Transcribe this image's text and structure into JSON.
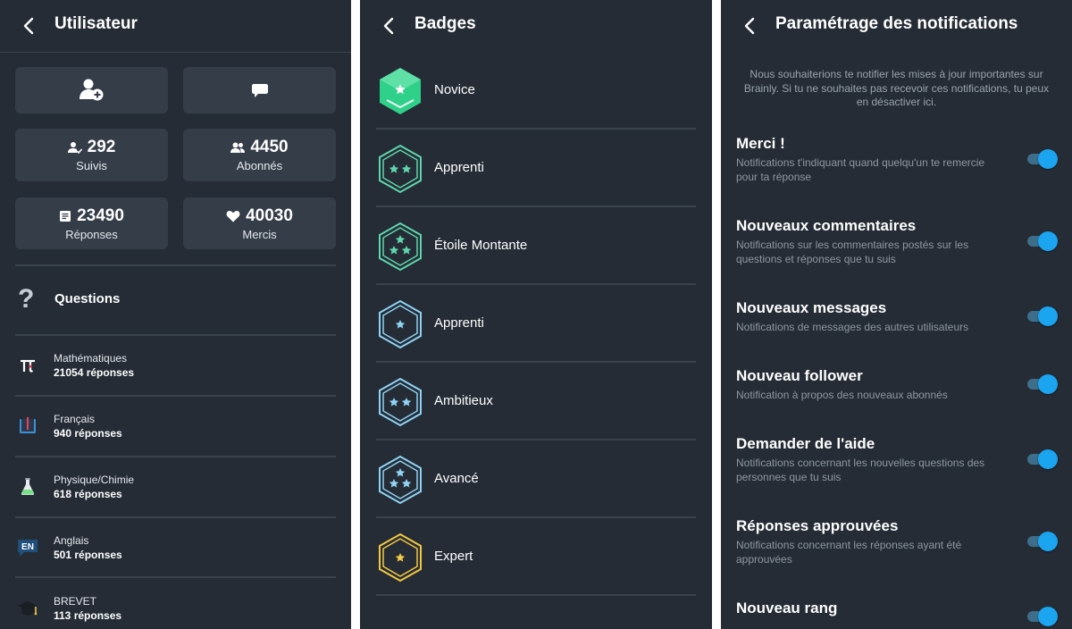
{
  "profile": {
    "title": "Utilisateur",
    "actions": [
      {
        "name": "add-friend",
        "icon": "add-user-icon"
      },
      {
        "name": "message",
        "icon": "chat-icon"
      }
    ],
    "stats": [
      {
        "value": "292",
        "label": "Suivis",
        "icon": "following-icon"
      },
      {
        "value": "4450",
        "label": "Abonnés",
        "icon": "followers-icon"
      },
      {
        "value": "23490",
        "label": "Réponses",
        "icon": "answers-icon"
      },
      {
        "value": "40030",
        "label": "Mercis",
        "icon": "heart-icon"
      }
    ],
    "questions_title": "Questions",
    "subjects": [
      {
        "name": "Mathématiques",
        "count": "21054 réponses",
        "icon": "pi-icon"
      },
      {
        "name": "Français",
        "count": "940 réponses",
        "icon": "book-icon"
      },
      {
        "name": "Physique/Chimie",
        "count": "618 réponses",
        "icon": "flask-icon"
      },
      {
        "name": "Anglais",
        "count": "501 réponses",
        "icon": "english-icon"
      },
      {
        "name": "BREVET",
        "count": "113 réponses",
        "icon": "graduation-cap-icon"
      }
    ],
    "english_icon_text": "EN"
  },
  "badges": {
    "title": "Badges",
    "items": [
      {
        "name": "Novice",
        "color": "#2fd08a",
        "stars": 1,
        "filled": true
      },
      {
        "name": "Apprenti",
        "color": "#5ed6ad",
        "stars": 2,
        "filled": false
      },
      {
        "name": "Étoile Montante",
        "color": "#5ed6ad",
        "stars": 3,
        "filled": false
      },
      {
        "name": "Apprenti",
        "color": "#8fd3f4",
        "stars": 1,
        "filled": false
      },
      {
        "name": "Ambitieux",
        "color": "#8fd3f4",
        "stars": 2,
        "filled": false
      },
      {
        "name": "Avancé",
        "color": "#8fd3f4",
        "stars": 3,
        "filled": false
      },
      {
        "name": "Expert",
        "color": "#f4c842",
        "stars": 1,
        "filled": false
      }
    ]
  },
  "notifications": {
    "title": "Paramétrage des notifications",
    "intro": "Nous souhaiterions te notifier les mises à jour importantes sur Brainly. Si tu ne souhaites pas recevoir ces notifications, tu peux en désactiver ici.",
    "items": [
      {
        "title": "Merci !",
        "desc": "Notifications t'indiquant quand quelqu'un te remercie pour ta réponse",
        "enabled": true
      },
      {
        "title": "Nouveaux commentaires",
        "desc": "Notifications sur les commentaires postés sur les questions et réponses que tu suis",
        "enabled": true
      },
      {
        "title": "Nouveaux messages",
        "desc": "Notifications de messages des autres utilisateurs",
        "enabled": true
      },
      {
        "title": "Nouveau follower",
        "desc": "Notification à propos des nouveaux abonnés",
        "enabled": true
      },
      {
        "title": "Demander de l'aide",
        "desc": "Notifications concernant les nouvelles questions des personnes que tu suis",
        "enabled": true
      },
      {
        "title": "Réponses approuvées",
        "desc": "Notifications concernant les réponses ayant été approuvées",
        "enabled": true
      },
      {
        "title": "Nouveau rang",
        "desc": "",
        "enabled": true
      }
    ]
  },
  "colors": {
    "background": "#252c35",
    "card": "#343d48",
    "toggle_on": "#1ba4f0",
    "divider": "#3a424c"
  }
}
